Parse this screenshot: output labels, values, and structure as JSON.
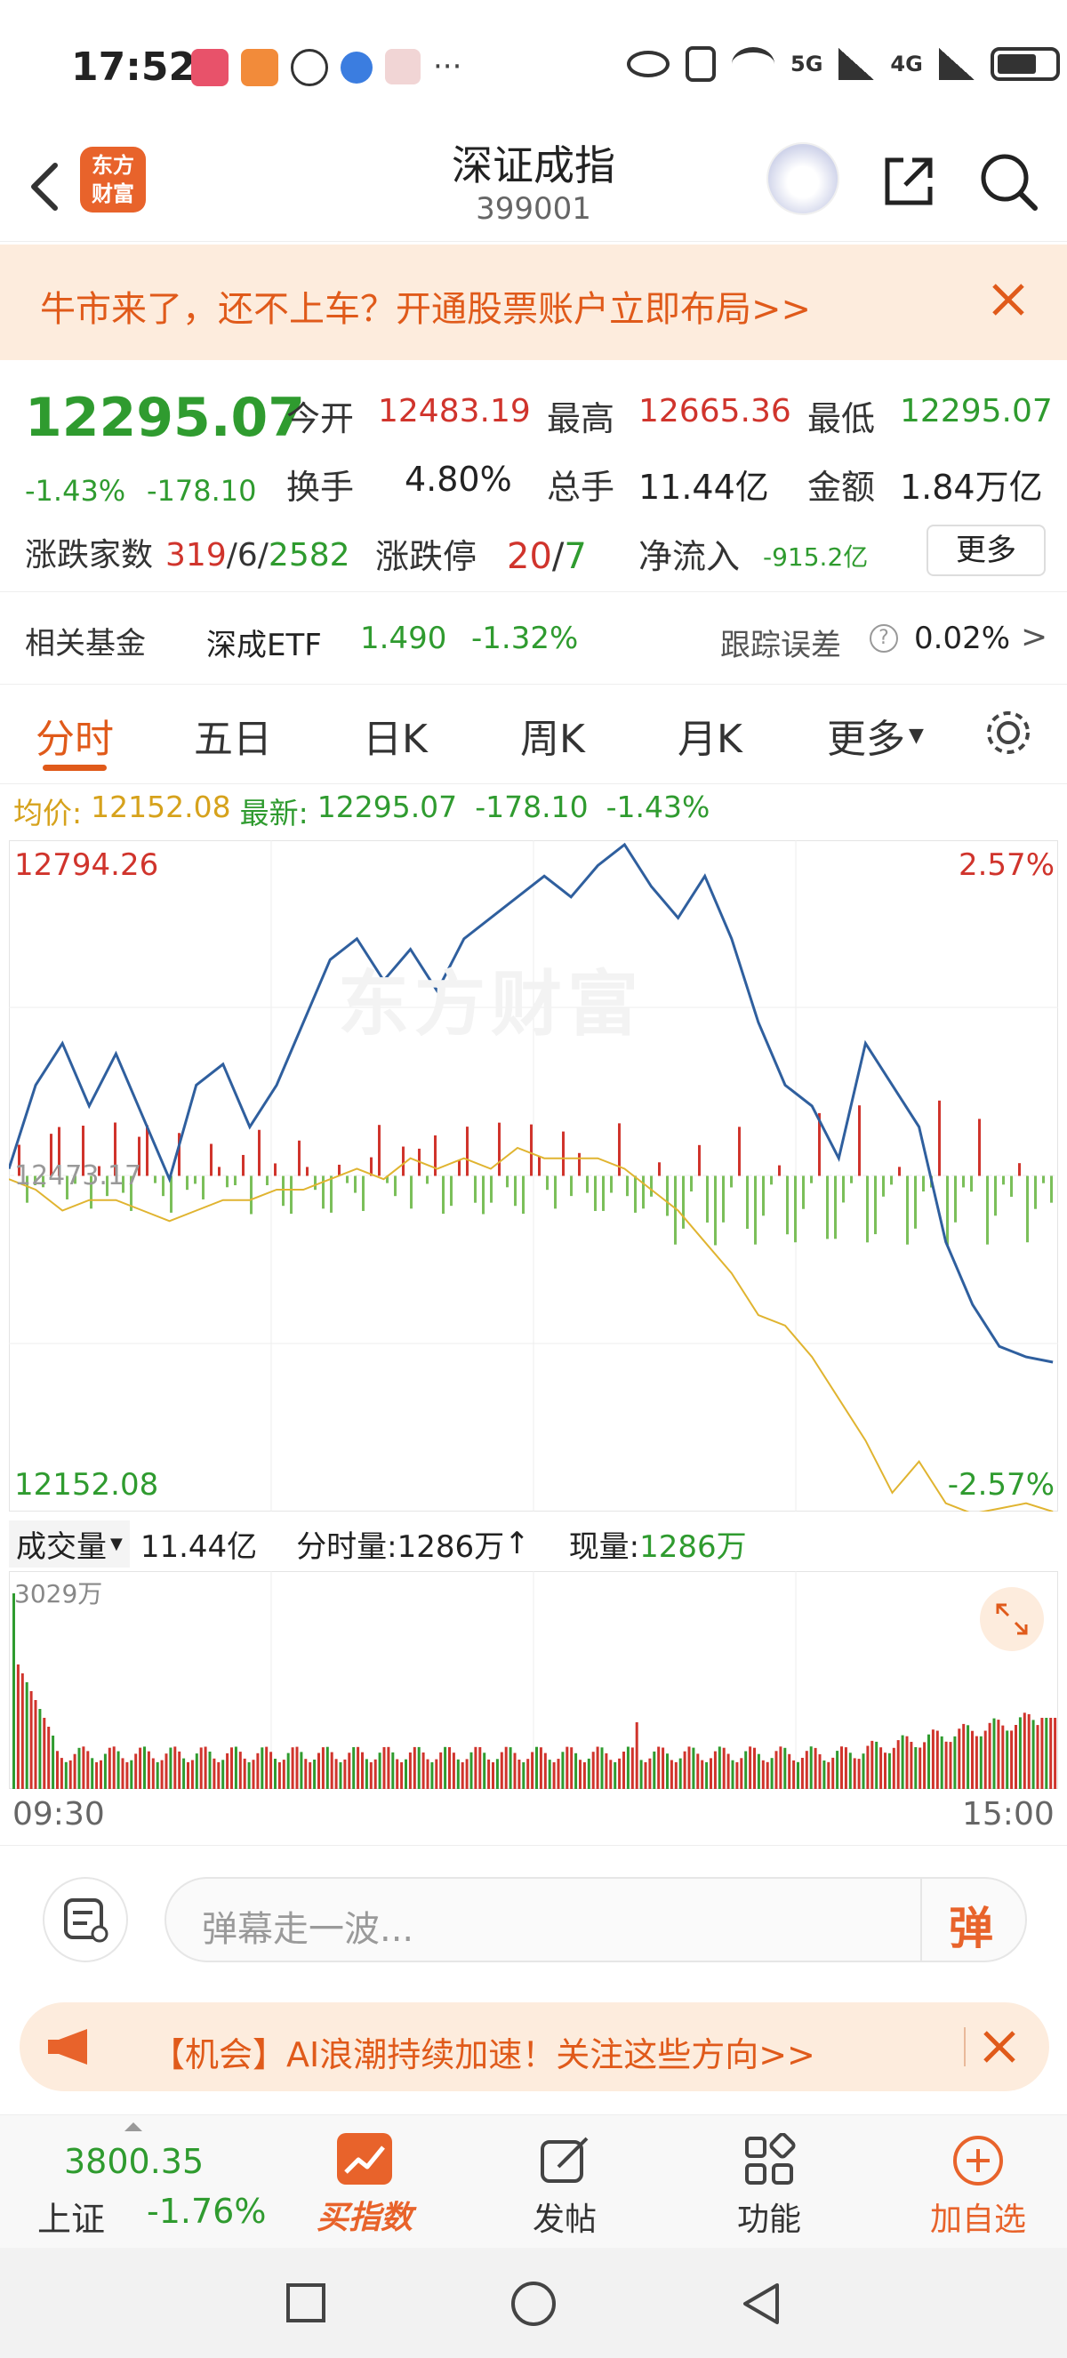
{
  "status_bar": {
    "time": "17:52",
    "network": "5G",
    "network2": "4G"
  },
  "header": {
    "title": "深证成指",
    "code": "399001",
    "logo_text_1": "东方",
    "logo_text_2": "财富"
  },
  "promo": {
    "text": "牛市来了，还不上车？开通股票账户立即布局>>"
  },
  "quote": {
    "price": "12295.07",
    "change_pct": "-1.43%",
    "change": "-178.10",
    "open_label": "今开",
    "open": "12483.19",
    "high_label": "最高",
    "high": "12665.36",
    "low_label": "最低",
    "low": "12295.07",
    "turnover_label": "换手",
    "turnover": "4.80%",
    "volume_label": "总手",
    "volume": "11.44亿",
    "amount_label": "金额",
    "amount": "1.84万亿",
    "breadth_label": "涨跌家数",
    "up_count": "319",
    "sep1": "/",
    "flat_count": "6",
    "sep2": "/",
    "down_count": "2582",
    "limit_label": "涨跌停",
    "limit_up": "20",
    "sep3": "/",
    "limit_down": "7",
    "netflow_label": "净流入",
    "netflow": "-915.2亿",
    "more_button": "更多"
  },
  "fund": {
    "label": "相关基金",
    "name": "深成ETF",
    "price": "1.490",
    "pct": "-1.32%",
    "tracking_label": "跟踪误差",
    "tracking": "0.02%",
    "arrow": ">"
  },
  "tabs": [
    {
      "label": "分时"
    },
    {
      "label": "五日"
    },
    {
      "label": "日K"
    },
    {
      "label": "周K"
    },
    {
      "label": "月K"
    },
    {
      "label": "更多"
    }
  ],
  "chart_info": {
    "avg_label": "均价:",
    "avg": "12152.08",
    "latest_label": "最新:",
    "latest": "12295.07",
    "latest_chg": "-178.10",
    "latest_pct": "-1.43%"
  },
  "chart_labels": {
    "top_left": "12794.26",
    "top_right": "2.57%",
    "mid_left": "12473.17",
    "bottom_left": "12152.08",
    "bottom_right": "-2.57%",
    "watermark": "东方财富"
  },
  "volume_bar": {
    "label": "成交量",
    "total": "11.44亿",
    "minute_label": "分时量:",
    "minute": "1286万",
    "arrow": "↑",
    "now_label": "现量:",
    "now": "1286万",
    "max_label": "3029万",
    "time_start": "09:30",
    "time_end": "15:00"
  },
  "comment": {
    "placeholder": "弹幕走一波...",
    "send_label": "弹"
  },
  "notice": {
    "text": "【机会】AI浪潮持续加速！关注这些方向>>"
  },
  "bottom_nav": {
    "index_value": "3800.35",
    "index_name": "上证",
    "index_pct": "-1.76%",
    "items": [
      {
        "label": "买指数"
      },
      {
        "label": "发帖"
      },
      {
        "label": "功能"
      },
      {
        "label": "加自选"
      }
    ]
  },
  "colors": {
    "up": "#d0342c",
    "down": "#2f9b2f",
    "accent": "#e8632b",
    "price_line": "#2f5f9e",
    "avg_line": "#e0b430"
  },
  "chart_data": {
    "type": "line",
    "title": "",
    "x_range": [
      "09:30",
      "15:00"
    ],
    "ylim": [
      12152.08,
      12794.26
    ],
    "pct_range": [
      "-2.57%",
      "2.57%"
    ],
    "prev_close": 12473.17,
    "series": [
      {
        "values": [
          12480,
          12560,
          12600,
          12540,
          12590,
          12530,
          12470,
          12560,
          12580,
          12520,
          12560,
          12620,
          12680,
          12700,
          12660,
          12690,
          12650,
          12700,
          12720,
          12740,
          12760,
          12740,
          12770,
          12790,
          12750,
          12720,
          12760,
          12700,
          12620,
          12560,
          12540,
          12490,
          12600,
          12560,
          12520,
          12410,
          12350,
          12310,
          12300,
          12295
        ]
      },
      {
        "values": [
          12470,
          12460,
          12440,
          12450,
          12450,
          12440,
          12430,
          12440,
          12450,
          12450,
          12460,
          12460,
          12470,
          12480,
          12470,
          12490,
          12480,
          12490,
          12480,
          12500,
          12490,
          12490,
          12490,
          12480,
          12460,
          12440,
          12410,
          12380,
          12340,
          12330,
          12300,
          12260,
          12220,
          12170,
          12200,
          12160,
          12150,
          12155,
          12160,
          12152
        ]
      }
    ]
  }
}
